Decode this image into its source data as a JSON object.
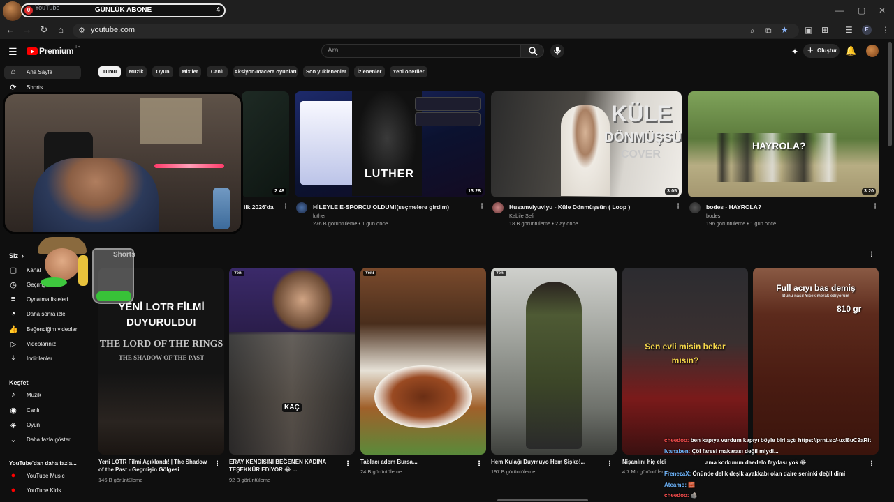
{
  "browser": {
    "tab_badge": "0",
    "tab_title": "YouTube",
    "overlay_title": "GÜNLÜK ABONE",
    "overlay_count": "4",
    "url": "youtube.com",
    "profile_initial": "E"
  },
  "header": {
    "logo_text": "Premium",
    "logo_country": "TR",
    "search_placeholder": "Ara",
    "create_label": "Oluştur"
  },
  "sidebar": {
    "top": [
      {
        "label": "Ana Sayfa",
        "icon": "home-icon"
      },
      {
        "label": "Shorts",
        "icon": "shorts-icon"
      }
    ],
    "you_heading": "Siz",
    "you_items": [
      {
        "label": "Kanal",
        "icon": "channel-icon"
      },
      {
        "label": "Geçmiş",
        "icon": "history-icon"
      },
      {
        "label": "Oynatma listeleri",
        "icon": "playlist-icon"
      },
      {
        "label": "Daha sonra izle",
        "icon": "watch-later-icon"
      },
      {
        "label": "Beğendiğim videolar",
        "icon": "like-icon"
      },
      {
        "label": "Videolarınız",
        "icon": "your-videos-icon"
      },
      {
        "label": "İndirilenler",
        "icon": "download-icon"
      }
    ],
    "explore_heading": "Keşfet",
    "explore_items": [
      {
        "label": "Müzik",
        "icon": "music-icon"
      },
      {
        "label": "Canlı",
        "icon": "live-icon"
      },
      {
        "label": "Oyun",
        "icon": "gaming-icon"
      },
      {
        "label": "Daha fazla göster",
        "icon": "chevron-down-icon"
      }
    ],
    "more_heading": "YouTube'dan daha fazla...",
    "more_items": [
      {
        "label": "YouTube Music",
        "icon": "youtube-music-icon"
      },
      {
        "label": "YouTube Kids",
        "icon": "youtube-kids-icon"
      }
    ]
  },
  "chips": [
    "Tümü",
    "Müzik",
    "Oyun",
    "Mix'ler",
    "Canlı",
    "Aksiyon-macera oyunları",
    "Son yüklenenler",
    "İzlenenler",
    "Yeni öneriler"
  ],
  "videos": [
    {
      "title": "ilk 2026'da",
      "duration": "2:48"
    },
    {
      "title": "HİLEYLE E-SPORCU OLDUM!(seçmelere girdim)",
      "channel": "luther",
      "meta": "276 B görüntüleme • 1 gün önce",
      "duration": "13:28",
      "thumb_text": "LUTHER"
    },
    {
      "title": "Husamviyuviyu - Küle Dönmüşsün ( Loop )",
      "channel": "Kabile Şefi",
      "meta": "18 B görüntüleme • 2 ay önce",
      "duration": "3:05",
      "thumb_text_1": "KÜLE",
      "thumb_text_2": "DÖNMÜŞSÜN",
      "thumb_text_3": "COVER"
    },
    {
      "title": "bodes - HAYROLA?",
      "channel": "bodes",
      "meta": "196 görüntüleme • 1 gün önce",
      "duration": "3:20",
      "thumb_text": "HAYROLA?"
    }
  ],
  "shorts_heading": "Shorts",
  "shorts": [
    {
      "title_1": "Yeni LOTR Filmi Açıklandı! | The Shadow",
      "title_2": "of the Past - Geçmişin Gölgesi",
      "meta": "146 B görüntüleme",
      "thumb_text_1": "YENİ LOTR FİLMİ",
      "thumb_text_2": "DUYURULDU!",
      "thumb_text_3": "THE LORD OF THE RINGS",
      "thumb_text_4": "THE SHADOW OF THE PAST"
    },
    {
      "title_1": "ERAY KENDİSİNİ BEĞENEN KADINA",
      "title_2": "TEŞEKKÜR EDİYOR 😂 ...",
      "meta": "92 B görüntüleme",
      "badge": "Yeni",
      "thumb_text": "KAÇ"
    },
    {
      "title_1": "Tablacı adem Bursa...",
      "meta": "24 B görüntüleme",
      "badge": "Yeni"
    },
    {
      "title_1": "Hem Kulağı Duymuyo Hem Şişko!...",
      "meta": "197 B görüntüleme",
      "badge": "Yeni"
    },
    {
      "title_1": "Nişanlını hiç eldi",
      "meta": "4,7 Mn görüntüleme",
      "thumb_text_1": "Sen evli misin bekar",
      "thumb_text_2": "mısın?"
    },
    {
      "title_1": "",
      "meta": "",
      "thumb_text_1": "Full acıyı bas demiş",
      "thumb_text_2": "Bunu nasıl Yicek merak ediyorum",
      "thumb_text_3": "810 gr"
    }
  ],
  "chat": [
    {
      "user": "cheedoo:",
      "text": "ben kapıya vurdum kapıyı böyle biri açtı https://prnt.sc/-uxl8uC9aRit"
    },
    {
      "user": "Ivanaben:",
      "text": "Çöl faresi makarası değil miydi..."
    },
    {
      "user": "",
      "text": "ama korkunun daedelo faydası yok 😂"
    },
    {
      "user": "FrenezaX:",
      "text": "Önünde delik deşik ayakkabı olan daire seninki değil dimi"
    },
    {
      "user": "Ateamo:",
      "text": "🧱"
    },
    {
      "user": "cheedoo:",
      "text": "🪨"
    }
  ],
  "colors": {
    "background": "#0f0f0f",
    "chip": "#272727",
    "accent_red": "#ff0000"
  }
}
